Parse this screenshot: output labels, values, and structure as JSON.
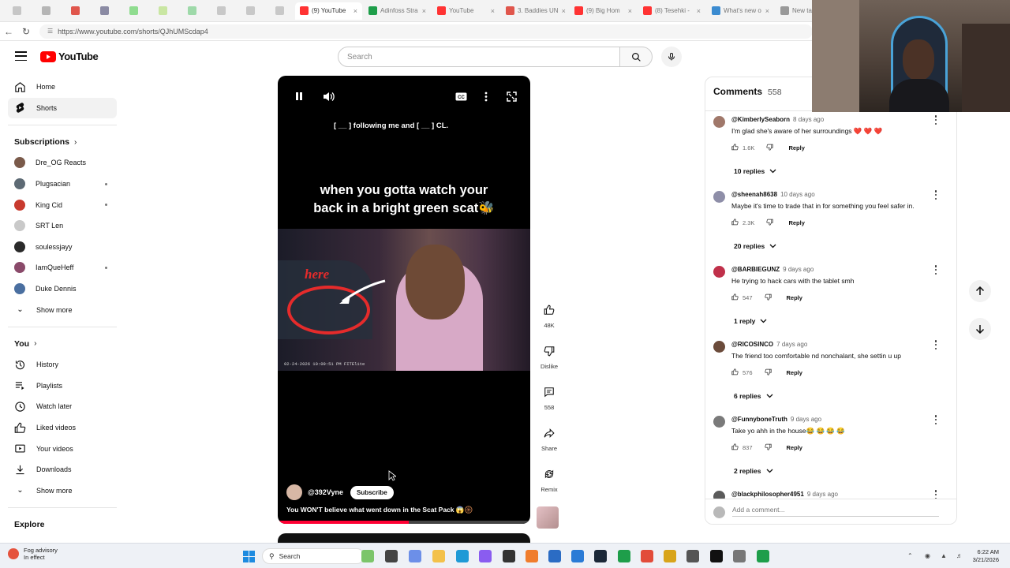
{
  "browser": {
    "tabs": [
      {
        "label": "",
        "color": "#c6c6c6",
        "kind": "small"
      },
      {
        "label": "",
        "color": "#b5b5b5",
        "kind": "small"
      },
      {
        "label": "",
        "color": "#e0564c",
        "kind": "small"
      },
      {
        "label": "",
        "color": "#8a8aa3",
        "kind": "small"
      },
      {
        "label": "",
        "color": "#8fdc8f",
        "kind": "small"
      },
      {
        "label": "",
        "color": "#c9e6a2",
        "kind": "small"
      },
      {
        "label": "",
        "color": "#9ed9a9",
        "kind": "small"
      },
      {
        "label": "",
        "color": "#c8c8c8",
        "kind": "small"
      },
      {
        "label": "",
        "color": "#c8c8c8",
        "kind": "small"
      },
      {
        "label": "",
        "color": "#c8c8c8",
        "kind": "small"
      },
      {
        "label": "(9) YouTube",
        "color": "#ff3333",
        "kind": "wide"
      },
      {
        "label": "Adinfoss Stra",
        "color": "#1e9e4a",
        "kind": "wide"
      },
      {
        "label": "YouTube",
        "color": "#ff3333",
        "kind": "wide"
      },
      {
        "label": "3. Baddies UN",
        "color": "#e0564c",
        "kind": "wide"
      },
      {
        "label": "(9) Big Hom",
        "color": "#ff3333",
        "kind": "wide"
      },
      {
        "label": "(8) Tesehki -",
        "color": "#ff3333",
        "kind": "wide"
      },
      {
        "label": "What's new o",
        "color": "#3b8bd0",
        "kind": "wide"
      },
      {
        "label": "New tab",
        "color": "#999999",
        "kind": "wide"
      }
    ],
    "url": "https://www.youtube.com/shorts/QJhUMScdap4"
  },
  "header": {
    "logo_text": "YouTube",
    "search_placeholder": "Search"
  },
  "sidebar": {
    "main": [
      {
        "label": "Home",
        "icon": "home-icon"
      },
      {
        "label": "Shorts",
        "icon": "shorts-icon",
        "active": true
      }
    ],
    "subscriptions_heading": "Subscriptions",
    "subscriptions": [
      {
        "label": "Dre_OG Reacts",
        "color": "#7a5a4a",
        "dot": false
      },
      {
        "label": "Plugsacian",
        "color": "#5d6a74",
        "dot": true
      },
      {
        "label": "King Cid",
        "color": "#c83a2e",
        "dot": true
      },
      {
        "label": "SRT Len",
        "color": "#c9c9c9",
        "dot": false
      },
      {
        "label": "soulessjayy",
        "color": "#2a2a2a",
        "dot": false
      },
      {
        "label": "IamQueHeff",
        "color": "#8a4a6a",
        "dot": true
      },
      {
        "label": "Duke Dennis",
        "color": "#4a6fa0",
        "dot": false
      }
    ],
    "sub_show_more": "Show more",
    "you_heading": "You",
    "you": [
      {
        "label": "History",
        "icon": "history-icon"
      },
      {
        "label": "Playlists",
        "icon": "playlists-icon"
      },
      {
        "label": "Watch later",
        "icon": "watch-later-icon"
      },
      {
        "label": "Liked videos",
        "icon": "liked-icon"
      },
      {
        "label": "Your videos",
        "icon": "your-videos-icon"
      },
      {
        "label": "Downloads",
        "icon": "downloads-icon"
      }
    ],
    "you_show_more": "Show more",
    "explore_heading": "Explore"
  },
  "video": {
    "caption": "[ __ ] following me and [ __ ] CL.",
    "overlay_title_line1": "when you gotta watch your",
    "overlay_title_line2": "back in a bright green scat🐝",
    "handwritten_label": "here",
    "timestamp": "02-24-2026 10:09:51 PM FITElite",
    "channel": "@392Vyne",
    "subscribe_label": "Subscribe",
    "description": "You WON'T believe what went down in the Scat Pack 😱🛞",
    "progress": 0.52
  },
  "actions": {
    "likes": "48K",
    "dislike": "Dislike",
    "comments": "558",
    "share": "Share",
    "remix": "Remix"
  },
  "comments": {
    "title": "Comments",
    "count": "558",
    "items": [
      {
        "user": "@KimberlySeaborn",
        "age": "8 days ago",
        "text": "I'm glad she's aware of her surroundings ❤️ ❤️ ❤️",
        "likes": "1.6K",
        "replies": "10 replies",
        "color": "#a0786a"
      },
      {
        "user": "@sheenah8638",
        "age": "10 days ago",
        "text": "Maybe it's time to trade that in for something you feel safer in.",
        "likes": "2.3K",
        "replies": "20 replies",
        "color": "#8e8ea8"
      },
      {
        "user": "@BARBIEGUNZ",
        "age": "9 days ago",
        "text": "He trying to hack cars with the tablet smh",
        "likes": "547",
        "replies": "1 reply",
        "color": "#c0304a"
      },
      {
        "user": "@RICOSINCO",
        "age": "7 days ago",
        "text": "The friend too comfortable nd nonchalant, she settin u up",
        "likes": "576",
        "replies": "6 replies",
        "color": "#6b4b3b"
      },
      {
        "user": "@FunnyboneTruth",
        "age": "9 days ago",
        "text": "Take yo ahh in the house😂 😂 😂 😂",
        "likes": "837",
        "replies": "2 replies",
        "color": "#7a7a7a"
      },
      {
        "user": "@blackphilosopher4951",
        "age": "9 days ago",
        "text": "",
        "likes": "",
        "replies": "",
        "color": "#5a5a5a"
      }
    ],
    "reply_label": "Reply",
    "add_placeholder": "Add a comment..."
  },
  "taskbar": {
    "weather_line1": "Fog advisory",
    "weather_line2": "In effect",
    "search_label": "Search",
    "time": "6:22 AM",
    "date": "3/21/2026"
  }
}
